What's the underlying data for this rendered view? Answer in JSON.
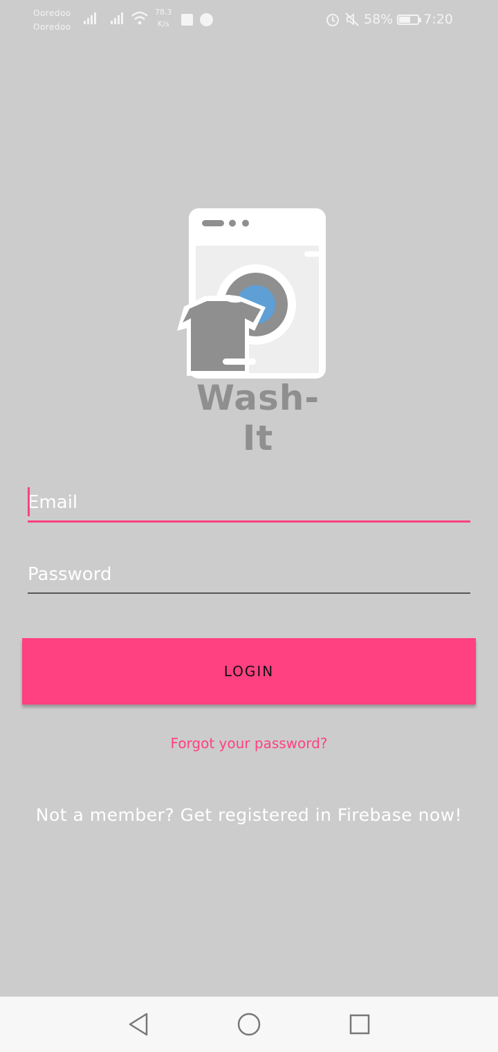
{
  "status_bar": {
    "carrier_1": "Ooredoo",
    "carrier_2": "Ooredoo",
    "speed_value": "78.3",
    "speed_unit": "K/s",
    "battery_percent": "58%",
    "battery_level": 0.58,
    "time": "7:20",
    "icons": [
      "signal-icon",
      "wifi-icon",
      "facebook-icon",
      "messenger-icon",
      "alarm-icon",
      "mute-icon",
      "battery-icon"
    ]
  },
  "logo": {
    "app_name": "Wash-It",
    "colors": {
      "frame": "#ffffff",
      "panel": "#eeeeee",
      "gray": "#8f8f8f",
      "water": "#5ea0d6"
    }
  },
  "form": {
    "email_placeholder": "Email",
    "email_value": "",
    "password_placeholder": "Password",
    "password_value": "",
    "login_label": "LOGIN",
    "forgot_label": "Forgot your password?",
    "register_label": "Not a member? Get registered in Firebase now!"
  },
  "colors": {
    "background": "#cccccc",
    "accent": "#ff4081",
    "nav_bar": "#f7f7f7"
  },
  "nav_bar": {
    "icons": [
      "back-icon",
      "home-icon",
      "recents-icon"
    ]
  }
}
